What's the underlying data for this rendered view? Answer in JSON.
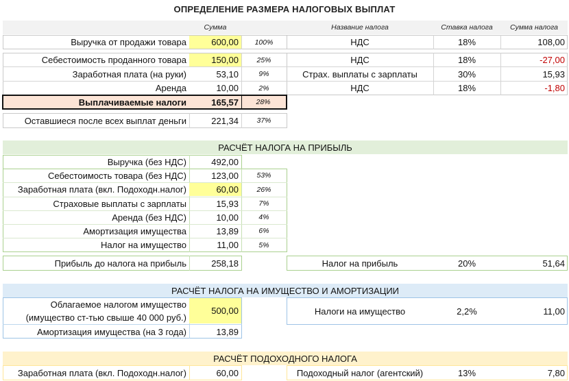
{
  "title": "ОПРЕДЕЛЕНИЕ РАЗМЕРА НАЛОГОВЫХ ВЫПЛАТ",
  "colors": {
    "yellow": "#ffff99",
    "green_band": "#e2efda",
    "blue_band": "#ddebf7",
    "orange_band": "#fce4d6",
    "total_row": "#fce4d6",
    "negative": "#c00000"
  },
  "top": {
    "headers": {
      "sum": "Сумма",
      "tax_name": "Название налога",
      "rate": "Ставка налога",
      "tax_sum": "Сумма налога"
    },
    "revenue": {
      "label": "Выручка от продажи товара",
      "value": "600,00",
      "pct": "100%",
      "tax": "НДС",
      "rate": "18%",
      "tax_sum": "108,00"
    },
    "rows": [
      {
        "label": "Себестоимость проданного товара",
        "value": "150,00",
        "pct": "25%",
        "tax": "НДС",
        "rate": "18%",
        "tax_sum": "-27,00"
      },
      {
        "label": "Заработная плата (на руки)",
        "value": "53,10",
        "pct": "9%",
        "tax": "Страх. выплаты с зарплаты",
        "rate": "30%",
        "tax_sum": "15,93"
      },
      {
        "label": "Аренда",
        "value": "10,00",
        "pct": "2%",
        "tax": "НДС",
        "rate": "18%",
        "tax_sum": "-1,80"
      }
    ],
    "total": {
      "label": "Выплачиваемые налоги",
      "value": "165,57",
      "pct": "28%"
    },
    "remaining": {
      "label": "Оставшиеся после всех выплат деньги",
      "value": "221,34",
      "pct": "37%"
    }
  },
  "profit": {
    "title": "РАСЧЁТ НАЛОГА НА ПРИБЫЛЬ",
    "rows": [
      {
        "label": "Выручка (без НДС)",
        "value": "492,00",
        "pct": ""
      },
      {
        "label": "Себестоимость товара (без НДС)",
        "value": "123,00",
        "pct": "53%"
      },
      {
        "label": "Заработная плата (вкл. Подоходн.налог)",
        "value": "60,00",
        "pct": "26%"
      },
      {
        "label": "Страховые выплаты с зарплаты",
        "value": "15,93",
        "pct": "7%"
      },
      {
        "label": "Аренда (без НДС)",
        "value": "10,00",
        "pct": "4%"
      },
      {
        "label": "Амортизация имущества",
        "value": "13,89",
        "pct": "6%"
      },
      {
        "label": "Налог на имущество",
        "value": "11,00",
        "pct": "5%"
      }
    ],
    "result": {
      "label": "Прибыль до налога на прибыль",
      "value": "258,18",
      "tax": "Налог на прибыль",
      "rate": "20%",
      "tax_sum": "51,64"
    }
  },
  "property": {
    "title": "РАСЧЁТ НАЛОГА НА ИМУЩЕСТВО И АМОРТИЗАЦИИ",
    "taxable_line1": "Облагаемое налогом имущество",
    "taxable_line2": "(имущество ст-тью свыше 40 000 руб.)",
    "taxable_value": "500,00",
    "tax": "Налоги на имущество",
    "rate": "2,2%",
    "tax_sum": "11,00",
    "amort_label": "Амортизация имущества (на 3 года)",
    "amort_value": "13,89"
  },
  "income": {
    "title": "РАСЧЁТ ПОДОХОДНОГО НАЛОГА",
    "label": "Заработная плата (вкл. Подоходн.налог)",
    "value": "60,00",
    "tax": "Подоходный налог (агентский)",
    "rate": "13%",
    "tax_sum": "7,80"
  }
}
